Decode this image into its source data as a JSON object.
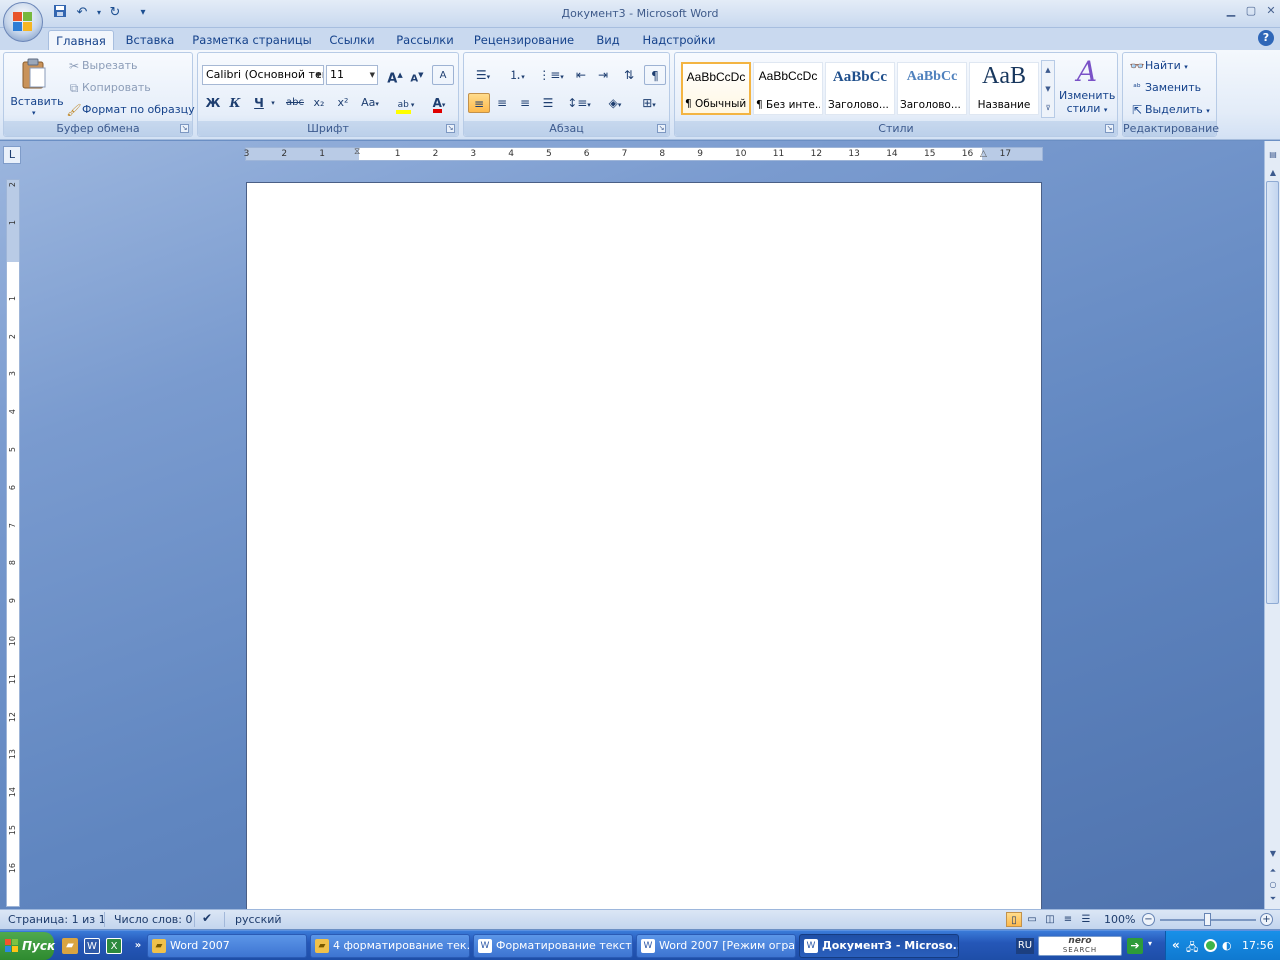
{
  "window": {
    "title": "Документ3 - Microsoft Word",
    "minimize": "▁",
    "maximize": "▢",
    "close": "✕"
  },
  "quick_access": {
    "customize": "▾"
  },
  "tabs": [
    {
      "label": "Главная"
    },
    {
      "label": "Вставка"
    },
    {
      "label": "Разметка страницы"
    },
    {
      "label": "Ссылки"
    },
    {
      "label": "Рассылки"
    },
    {
      "label": "Рецензирование"
    },
    {
      "label": "Вид"
    },
    {
      "label": "Надстройки"
    }
  ],
  "help": "?",
  "ribbon": {
    "clipboard": {
      "label": "Буфер обмена",
      "paste": "Вставить",
      "cut": "Вырезать",
      "copy": "Копировать",
      "format_painter": "Формат по образцу"
    },
    "font": {
      "label": "Шрифт",
      "font_name": "Calibri (Основной текст)",
      "font_size": "11",
      "bold": "Ж",
      "italic": "К",
      "underline": "Ч",
      "strike": "abc",
      "subscript": "x₂",
      "superscript": "x²",
      "change_case": "Aa",
      "grow": "A",
      "shrink": "A",
      "clear": "A",
      "highlight": "ab",
      "font_color": "A"
    },
    "paragraph": {
      "label": "Абзац",
      "show_marks": "¶"
    },
    "styles": {
      "label": "Стили",
      "items": [
        {
          "sample": "AaBbCcDc",
          "name": "¶ Обычный"
        },
        {
          "sample": "AaBbCcDc",
          "name": "¶ Без инте..."
        },
        {
          "sample": "AaBbCc",
          "name": "Заголово..."
        },
        {
          "sample": "AaBbCc",
          "name": "Заголово..."
        },
        {
          "sample": "AaB",
          "name": "Название"
        }
      ],
      "change_styles_1": "Изменить",
      "change_styles_2": "стили"
    },
    "editing": {
      "label": "Редактирование",
      "find": "Найти",
      "replace": "Заменить",
      "select": "Выделить"
    }
  },
  "ruler": {
    "corner": "L",
    "h_numbers": [
      "3",
      "2",
      "1",
      "1",
      "2",
      "3",
      "4",
      "5",
      "6",
      "7",
      "8",
      "9",
      "10",
      "11",
      "12",
      "13",
      "14",
      "15",
      "16",
      "17"
    ],
    "v_numbers": [
      "2",
      "1",
      "1",
      "2",
      "3",
      "4",
      "5",
      "6",
      "7",
      "8",
      "9",
      "10",
      "11",
      "12",
      "13",
      "14",
      "15",
      "16",
      "17"
    ]
  },
  "status": {
    "page": "Страница: 1 из 1",
    "words": "Число слов: 0",
    "language": "русский",
    "zoom": "100%",
    "zoom_level": 100
  },
  "taskbar": {
    "start": "Пуск",
    "more": "»",
    "tasks": [
      {
        "label": "Word 2007"
      },
      {
        "label": "4 форматирование тек..."
      },
      {
        "label": "Форматирование текст..."
      },
      {
        "label": "Word 2007 [Режим огра..."
      },
      {
        "label": "Документ3 - Microso..."
      }
    ],
    "lang": "RU",
    "search_brand": "nero",
    "search_sub": "SEARCH",
    "tray_more": "«",
    "clock": "17:56"
  }
}
